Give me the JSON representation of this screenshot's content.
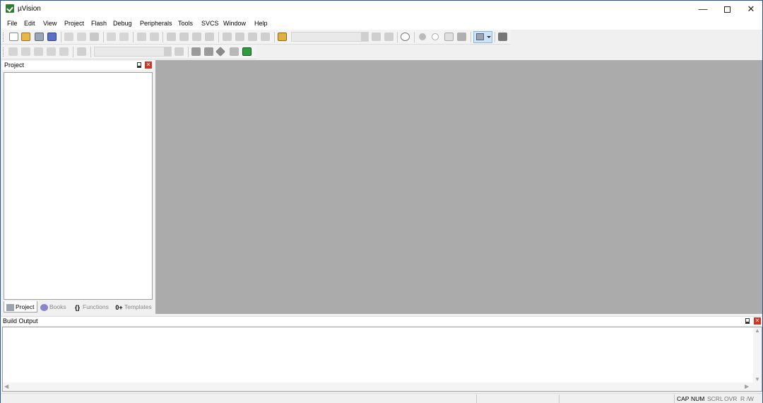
{
  "window": {
    "title": "µVision",
    "minimize_glyph": "—",
    "close_glyph": "✕"
  },
  "menu": [
    "File",
    "Edit",
    "View",
    "Project",
    "Flash",
    "Debug",
    "Peripherals",
    "Tools",
    "SVCS",
    "Window",
    "Help"
  ],
  "toolbar1": {
    "icons": [
      "new-file-icon",
      "open-file-icon",
      "save-icon",
      "save-all-icon",
      "cut-icon",
      "copy-icon",
      "paste-icon",
      "undo-icon",
      "redo-icon",
      "navigate-back-icon",
      "navigate-forward-icon",
      "bookmark-icon",
      "bookmark-prev-icon",
      "bookmark-next-icon",
      "bookmark-clear-icon",
      "indent-icon",
      "unindent-icon",
      "comment-icon",
      "uncomment-icon",
      "find-in-files-icon",
      "find-icon",
      "incremental-find-icon",
      "search-icon",
      "debug-session-icon",
      "breakpoint-icon",
      "disable-breakpoint-icon",
      "kill-breakpoints-icon",
      "window-layout-icon",
      "configure-icon"
    ],
    "find_combo_value": ""
  },
  "toolbar2": {
    "icons": [
      "translate-icon",
      "build-icon",
      "rebuild-icon",
      "batch-build-icon",
      "stop-build-icon",
      "download-icon",
      "options-for-target-icon",
      "file-extensions-icon",
      "manage-runtime-icon",
      "select-packs-icon",
      "pack-installer-icon",
      "event-recorder-icon"
    ],
    "target_combo_value": ""
  },
  "project_pane": {
    "title": "Project",
    "tabs": [
      {
        "label": "Project",
        "active": true
      },
      {
        "label": "Books",
        "active": false
      },
      {
        "label": "Functions",
        "active": false
      },
      {
        "label": "Templates",
        "active": false
      }
    ]
  },
  "build_output": {
    "title": "Build Output"
  },
  "status_bar": [
    "CAP",
    "NUM",
    "SCRL",
    "OVR",
    "R /W"
  ],
  "colors": {
    "editor_bg": "#ababab",
    "close_red": "#d9301f",
    "accent_blue": "#cce4f7"
  }
}
